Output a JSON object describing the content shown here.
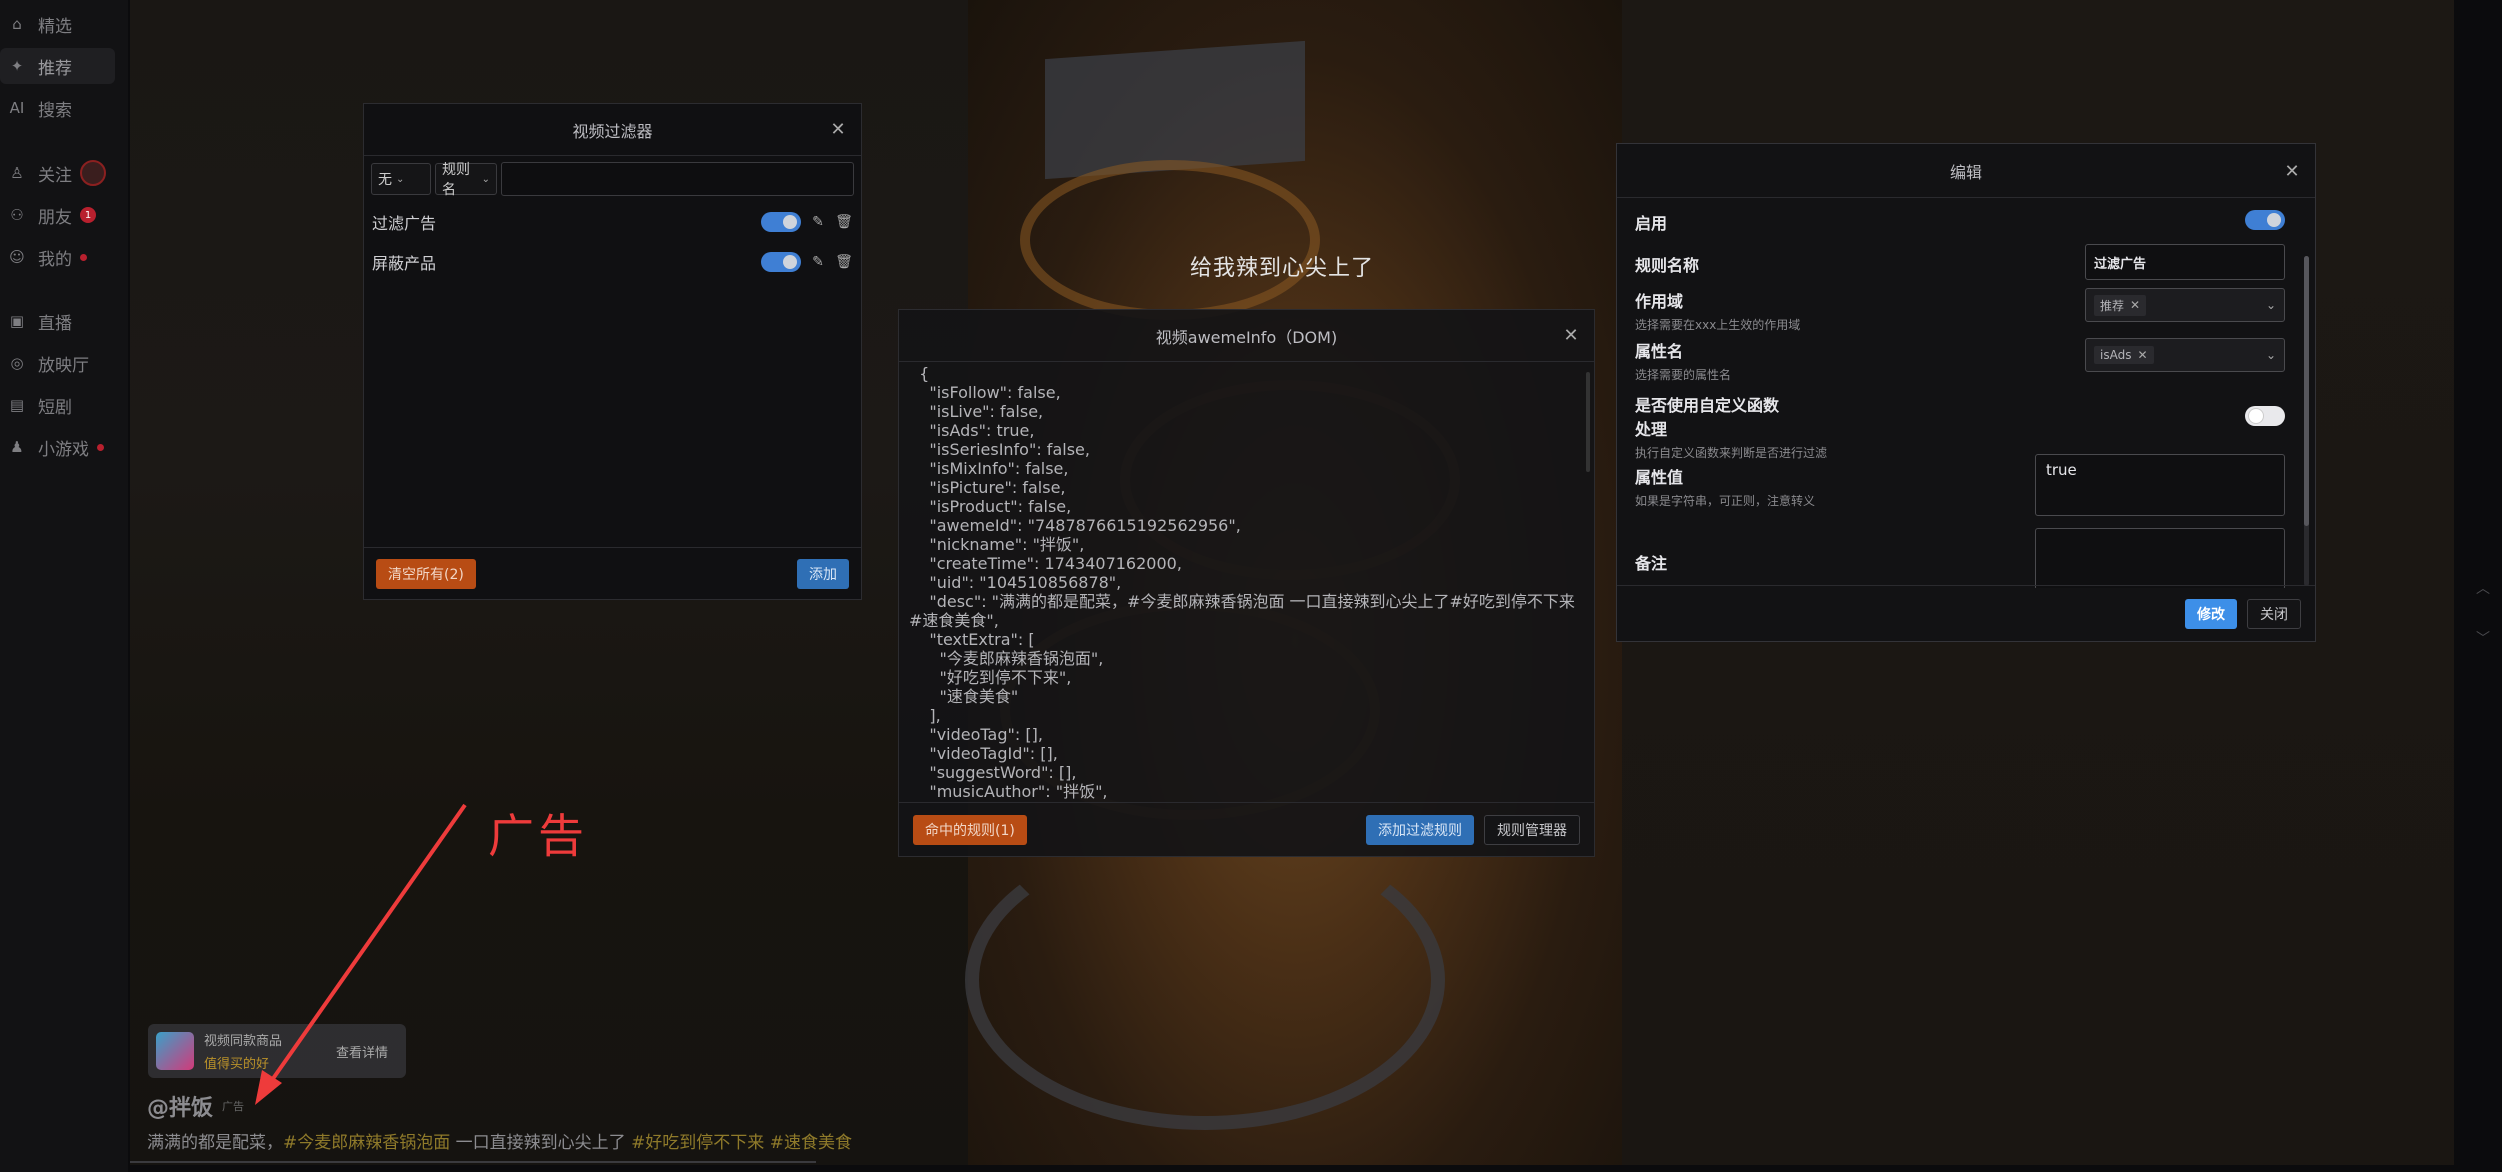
{
  "sidebar": {
    "items": [
      {
        "label": "精选",
        "icon": "home-icon"
      },
      {
        "label": "推荐",
        "icon": "sparkle-icon",
        "active": true
      },
      {
        "label": "搜索",
        "icon": "ai-icon",
        "icon_text": "AI"
      },
      {
        "label": "关注",
        "icon": "user-follow-icon"
      },
      {
        "label": "朋友",
        "icon": "friends-icon",
        "badge": "1"
      },
      {
        "label": "我的",
        "icon": "profile-icon"
      },
      {
        "label": "直播",
        "icon": "tv-icon"
      },
      {
        "label": "放映厅",
        "icon": "cinema-icon"
      },
      {
        "label": "短剧",
        "icon": "short-drama-icon"
      },
      {
        "label": "小游戏",
        "icon": "game-icon"
      }
    ]
  },
  "video": {
    "subtitle": "给我辣到心尖上了",
    "shop_card": {
      "title": "视频同款商品",
      "subtitle": "值得买的好",
      "button": "查看详情"
    },
    "author": "@拌饭",
    "ad_tag": "广告",
    "desc_plain_1": "满满的都是配菜，",
    "desc_tag_1": "#今麦郎麻辣香锅泡面",
    "desc_plain_2": " 一口直接辣到心尖上了 ",
    "desc_tag_2": "#好吃到停不下来",
    "desc_tag_3": " #速食美食"
  },
  "annotation": {
    "text": "广告",
    "color": "#ee3b3b"
  },
  "filter_panel": {
    "title": "视频过滤器",
    "select_1": "无",
    "select_2": "规则名",
    "rules": [
      {
        "name": "过滤广告",
        "enabled": true
      },
      {
        "name": "屏蔽产品",
        "enabled": true
      }
    ],
    "clear_button": "清空所有(2)",
    "add_button": "添加"
  },
  "dom_panel": {
    "title": "视频awemeInfo（DOM)",
    "code_lines": [
      "  {",
      "    \"isFollow\": false,",
      "    \"isLive\": false,",
      "    \"isAds\": true,",
      "    \"isSeriesInfo\": false,",
      "    \"isMixInfo\": false,",
      "    \"isPicture\": false,",
      "    \"isProduct\": false,",
      "    \"awemeId\": \"7487876615192562956\",",
      "    \"nickname\": \"拌饭\",",
      "    \"createTime\": 1743407162000,",
      "    \"uid\": \"104510856878\",",
      "    \"desc\": \"满满的都是配菜，#今麦郎麻辣香锅泡面 一口直接辣到心尖上了#好吃到停不下来",
      "#速食美食\",",
      "    \"textExtra\": [",
      "      \"今麦郎麻辣香锅泡面\",",
      "      \"好吃到停不下来\",",
      "      \"速食美食\"",
      "    ],",
      "    \"videoTag\": [],",
      "    \"videoTagId\": [],",
      "    \"suggestWord\": [],",
      "    \"musicAuthor\": \"拌饭\","
    ],
    "hit_rules_button": "命中的规则(1)",
    "add_filter_button": "添加过滤规则",
    "rule_manager_button": "规则管理器"
  },
  "edit_panel": {
    "title": "编辑",
    "enabled_label": "启用",
    "enabled": true,
    "rule_name_label": "规则名称",
    "rule_name_value": "过滤广告",
    "scope_label": "作用域",
    "scope_hint": "选择需要在xxx上生效的作用域",
    "scope_chip": "推荐",
    "attr_label": "属性名",
    "attr_hint": "选择需要的属性名",
    "attr_chip": "isAds",
    "custom_fn_label_1": "是否使用自定义函数",
    "custom_fn_label_2": "处理",
    "custom_fn_hint": "执行自定义函数来判断是否进行过滤",
    "custom_fn_enabled": false,
    "value_label": "属性值",
    "value_hint": "如果是字符串，可正则，注意转义",
    "value_text": "true",
    "note_label": "备注",
    "note_text": "",
    "save_button": "修改",
    "close_button": "关闭"
  }
}
